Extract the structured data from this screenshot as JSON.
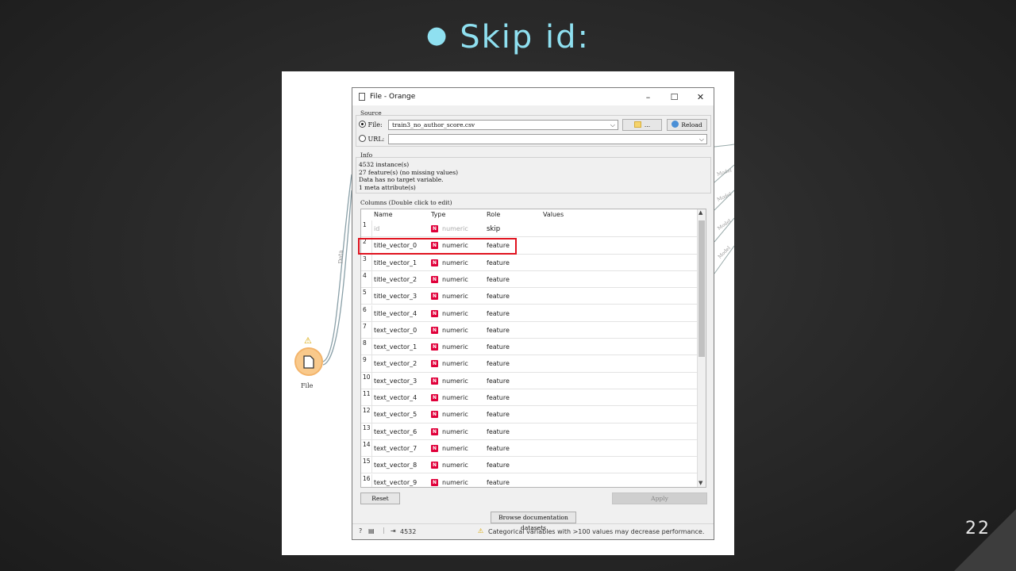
{
  "slide": {
    "title": "Skip id:",
    "page_number": "22"
  },
  "canvas": {
    "node_label": "File",
    "link_label": "Data",
    "model_labels": [
      "Model",
      "Model",
      "Model",
      "Model"
    ]
  },
  "dialog": {
    "title": "File - Orange",
    "window_buttons": {
      "minimize": "–",
      "maximize": "☐",
      "close": "✕"
    },
    "source": {
      "section": "Source",
      "file_label": "File:",
      "file_value": "train3_no_author_score.csv",
      "browse_label": "...",
      "reload_label": "Reload",
      "url_label": "URL:",
      "url_value": ""
    },
    "info": {
      "section": "Info",
      "lines": [
        "4532 instance(s)",
        "27 feature(s) (no missing values)",
        "Data has no target variable.",
        "1 meta attribute(s)"
      ]
    },
    "columns": {
      "section": "Columns (Double click to edit)",
      "headers": {
        "name": "Name",
        "type": "Type",
        "role": "Role",
        "values": "Values"
      },
      "type_icon": "N",
      "rows": [
        {
          "num": "1",
          "name": "id",
          "type": "numeric",
          "role": "skip"
        },
        {
          "num": "2",
          "name": "title_vector_0",
          "type": "numeric",
          "role": "feature"
        },
        {
          "num": "3",
          "name": "title_vector_1",
          "type": "numeric",
          "role": "feature"
        },
        {
          "num": "4",
          "name": "title_vector_2",
          "type": "numeric",
          "role": "feature"
        },
        {
          "num": "5",
          "name": "title_vector_3",
          "type": "numeric",
          "role": "feature"
        },
        {
          "num": "6",
          "name": "title_vector_4",
          "type": "numeric",
          "role": "feature"
        },
        {
          "num": "7",
          "name": "text_vector_0",
          "type": "numeric",
          "role": "feature"
        },
        {
          "num": "8",
          "name": "text_vector_1",
          "type": "numeric",
          "role": "feature"
        },
        {
          "num": "9",
          "name": "text_vector_2",
          "type": "numeric",
          "role": "feature"
        },
        {
          "num": "10",
          "name": "text_vector_3",
          "type": "numeric",
          "role": "feature"
        },
        {
          "num": "11",
          "name": "text_vector_4",
          "type": "numeric",
          "role": "feature"
        },
        {
          "num": "12",
          "name": "text_vector_5",
          "type": "numeric",
          "role": "feature"
        },
        {
          "num": "13",
          "name": "text_vector_6",
          "type": "numeric",
          "role": "feature"
        },
        {
          "num": "14",
          "name": "text_vector_7",
          "type": "numeric",
          "role": "feature"
        },
        {
          "num": "15",
          "name": "text_vector_8",
          "type": "numeric",
          "role": "feature"
        },
        {
          "num": "16",
          "name": "text_vector_9",
          "type": "numeric",
          "role": "feature"
        }
      ]
    },
    "buttons": {
      "reset": "Reset",
      "apply": "Apply",
      "browse_docs": "Browse documentation datasets"
    },
    "status": {
      "output_count": "4532",
      "warning": "Categorical variables with >100 values may decrease performance."
    }
  },
  "colors": {
    "title_cyan": "#8fe0f0",
    "highlight_red": "#e0131f",
    "numeric_icon": "#e0003a",
    "node_fill": "#f9c98b"
  }
}
